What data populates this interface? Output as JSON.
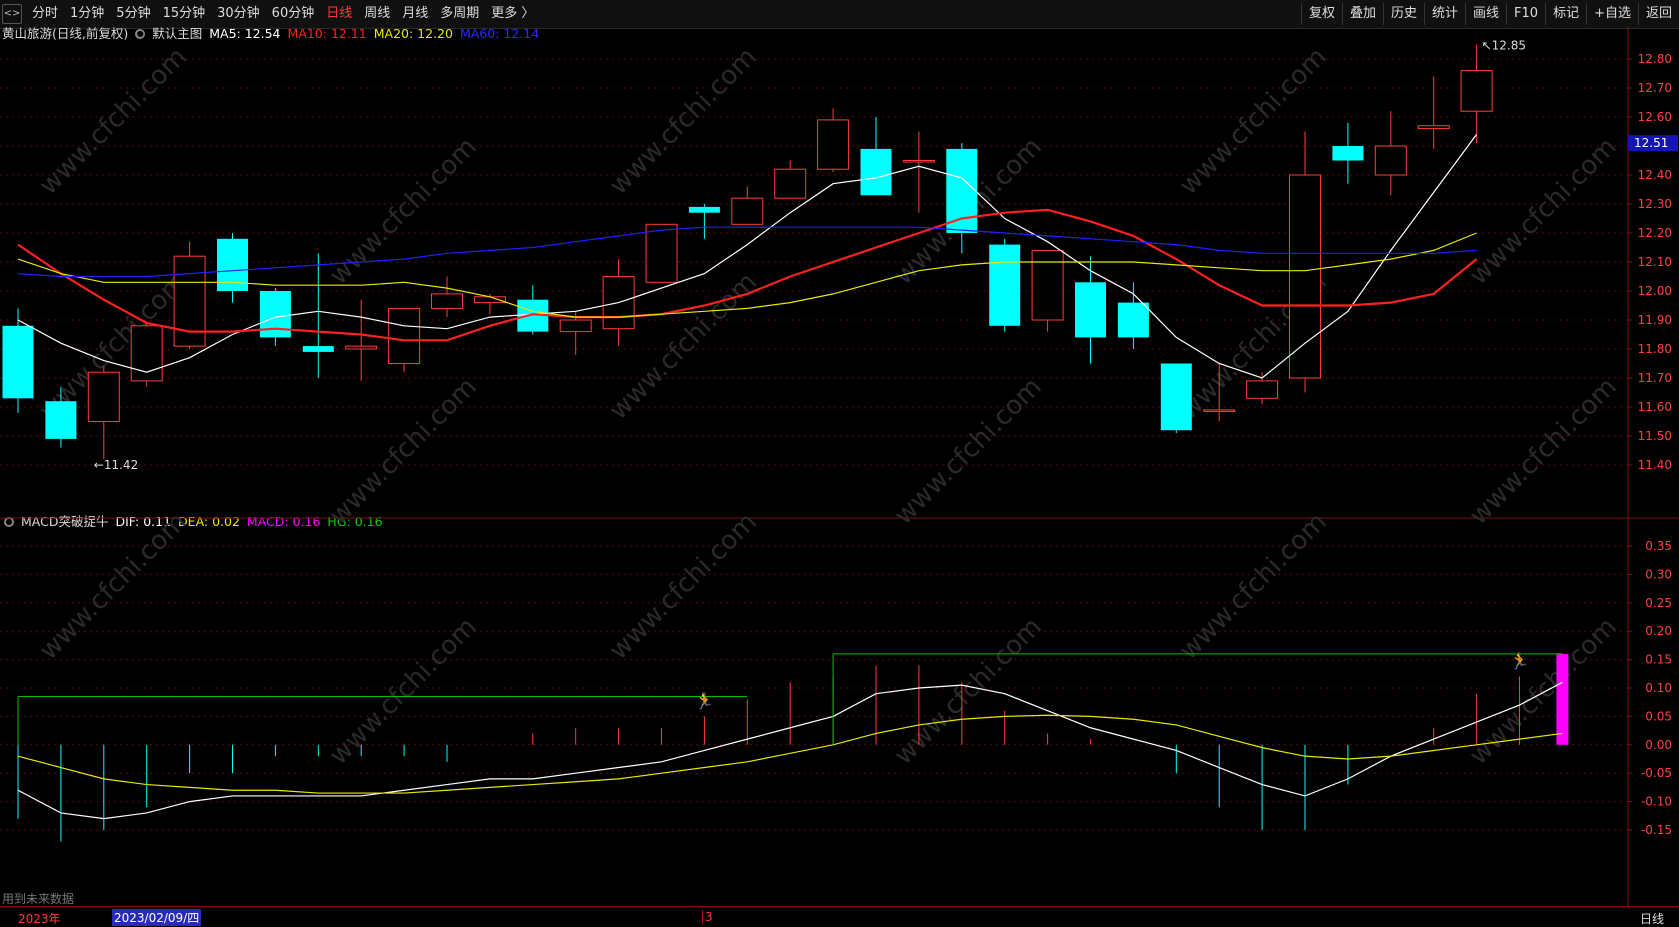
{
  "toolbar": {
    "periods": [
      "分时",
      "1分钟",
      "5分钟",
      "15分钟",
      "30分钟",
      "60分钟",
      "日线",
      "周线",
      "月线",
      "多周期",
      "更多 〉"
    ],
    "active_period": "日线",
    "right_buttons": [
      "复权",
      "叠加",
      "历史",
      "统计",
      "画线",
      "F10",
      "标记",
      "+自选",
      "返回"
    ]
  },
  "main_info": {
    "title": "黄山旅游(日线,前复权)",
    "template": "默认主图",
    "ma5": "MA5: 12.54",
    "ma10": "MA10: 12.11",
    "ma20": "MA20: 12.20",
    "ma60": "MA60: 12.14"
  },
  "macd_info": {
    "title": "MACD突破捉牛",
    "dif": "DIF: 0.11",
    "dea": "DEA: 0.02",
    "macd": "MACD: 0.16",
    "hg": "HG: 0.16"
  },
  "status": {
    "note": "用到未来数据",
    "year": "2023年",
    "cursor_date": "2023/02/09/四",
    "month_mark": "3",
    "period": "日线"
  },
  "watermark": "www.cfchi.com",
  "colors": {
    "up": "#ff3c3c",
    "down": "#00ffff",
    "ma5": "#ffffff",
    "ma10": "#ff2020",
    "ma20": "#e8e800",
    "ma60": "#2020ff",
    "dif": "#ffffff",
    "dea": "#e8e800",
    "macd_hist": "#ff00ff",
    "hg": "#00c000",
    "axis": "#7a1010"
  },
  "chart_data": [
    {
      "type": "candlestick",
      "title": "黄山旅游(日线,前复权)",
      "ylim": [
        11.35,
        12.9
      ],
      "yticks": [
        "12.80",
        "12.70",
        "12.60",
        "12.50",
        "12.40",
        "12.30",
        "12.20",
        "12.10",
        "12.00",
        "11.90",
        "11.80",
        "11.70",
        "11.60",
        "11.50",
        "11.40"
      ],
      "current_price": "12.51",
      "high_label": "12.85",
      "low_label": "11.42",
      "candles": [
        {
          "o": 11.88,
          "c": 11.63,
          "h": 11.94,
          "l": 11.58
        },
        {
          "o": 11.62,
          "c": 11.49,
          "h": 11.67,
          "l": 11.46
        },
        {
          "o": 11.55,
          "c": 11.72,
          "h": 11.74,
          "l": 11.42
        },
        {
          "o": 11.69,
          "c": 11.88,
          "h": 11.89,
          "l": 11.67
        },
        {
          "o": 11.81,
          "c": 12.12,
          "h": 12.17,
          "l": 11.8
        },
        {
          "o": 12.18,
          "c": 12.0,
          "h": 12.2,
          "l": 11.96
        },
        {
          "o": 12.0,
          "c": 11.84,
          "h": 12.01,
          "l": 11.81
        },
        {
          "o": 11.81,
          "c": 11.79,
          "h": 12.13,
          "l": 11.7
        },
        {
          "o": 11.8,
          "c": 11.81,
          "h": 11.97,
          "l": 11.69
        },
        {
          "o": 11.75,
          "c": 11.94,
          "h": 11.94,
          "l": 11.72
        },
        {
          "o": 11.94,
          "c": 11.99,
          "h": 12.05,
          "l": 11.91
        },
        {
          "o": 11.96,
          "c": 11.98,
          "h": 11.99,
          "l": 11.92
        },
        {
          "o": 11.97,
          "c": 11.86,
          "h": 12.02,
          "l": 11.85
        },
        {
          "o": 11.86,
          "c": 11.9,
          "h": 11.93,
          "l": 11.78
        },
        {
          "o": 11.87,
          "c": 12.05,
          "h": 12.11,
          "l": 11.81
        },
        {
          "o": 12.03,
          "c": 12.23,
          "h": 12.23,
          "l": 12.03
        },
        {
          "o": 12.29,
          "c": 12.27,
          "h": 12.3,
          "l": 12.18
        },
        {
          "o": 12.23,
          "c": 12.32,
          "h": 12.36,
          "l": 12.23
        },
        {
          "o": 12.32,
          "c": 12.42,
          "h": 12.45,
          "l": 12.32
        },
        {
          "o": 12.42,
          "c": 12.59,
          "h": 12.63,
          "l": 12.41
        },
        {
          "o": 12.49,
          "c": 12.33,
          "h": 12.6,
          "l": 12.33
        },
        {
          "o": 12.45,
          "c": 12.45,
          "h": 12.55,
          "l": 12.27
        },
        {
          "o": 12.49,
          "c": 12.2,
          "h": 12.51,
          "l": 12.13
        },
        {
          "o": 12.16,
          "c": 11.88,
          "h": 12.18,
          "l": 11.86
        },
        {
          "o": 11.9,
          "c": 12.14,
          "h": 12.14,
          "l": 11.86
        },
        {
          "o": 12.03,
          "c": 11.84,
          "h": 12.12,
          "l": 11.75
        },
        {
          "o": 11.96,
          "c": 11.84,
          "h": 12.03,
          "l": 11.8
        },
        {
          "o": 11.75,
          "c": 11.52,
          "h": 11.75,
          "l": 11.51
        },
        {
          "o": 11.59,
          "c": 11.59,
          "h": 11.75,
          "l": 11.55
        },
        {
          "o": 11.63,
          "c": 11.69,
          "h": 11.72,
          "l": 11.61
        },
        {
          "o": 11.7,
          "c": 12.4,
          "h": 12.55,
          "l": 11.65
        },
        {
          "o": 12.5,
          "c": 12.45,
          "h": 12.58,
          "l": 12.37
        },
        {
          "o": 12.4,
          "c": 12.5,
          "h": 12.62,
          "l": 12.33
        },
        {
          "o": 12.56,
          "c": 12.57,
          "h": 12.74,
          "l": 12.49
        },
        {
          "o": 12.62,
          "c": 12.76,
          "h": 12.85,
          "l": 12.51
        }
      ],
      "series": [
        {
          "name": "MA5",
          "values": [
            11.9,
            11.82,
            11.76,
            11.72,
            11.77,
            11.85,
            11.91,
            11.93,
            11.91,
            11.88,
            11.87,
            11.91,
            11.92,
            11.93,
            11.96,
            12.01,
            12.06,
            12.16,
            12.27,
            12.37,
            12.39,
            12.43,
            12.39,
            12.25,
            12.17,
            12.07,
            11.99,
            11.84,
            11.75,
            11.7,
            11.82,
            11.93,
            12.14,
            12.34,
            12.54
          ]
        },
        {
          "name": "MA10",
          "values": [
            12.16,
            12.06,
            11.97,
            11.89,
            11.86,
            11.86,
            11.87,
            11.86,
            11.85,
            11.83,
            11.83,
            11.88,
            11.92,
            11.91,
            11.91,
            11.92,
            11.95,
            11.99,
            12.05,
            12.1,
            12.15,
            12.2,
            12.25,
            12.27,
            12.28,
            12.24,
            12.19,
            12.11,
            12.02,
            11.95,
            11.95,
            11.95,
            11.96,
            11.99,
            12.11
          ]
        },
        {
          "name": "MA20",
          "values": [
            12.11,
            12.06,
            12.03,
            12.03,
            12.03,
            12.03,
            12.02,
            12.02,
            12.02,
            12.03,
            12.01,
            11.98,
            11.93,
            11.91,
            11.91,
            11.92,
            11.93,
            11.94,
            11.96,
            11.99,
            12.03,
            12.07,
            12.09,
            12.1,
            12.1,
            12.1,
            12.1,
            12.09,
            12.08,
            12.07,
            12.07,
            12.09,
            12.11,
            12.14,
            12.2
          ]
        },
        {
          "name": "MA60",
          "values": [
            12.06,
            12.05,
            12.05,
            12.05,
            12.06,
            12.07,
            12.08,
            12.09,
            12.1,
            12.11,
            12.13,
            12.14,
            12.15,
            12.17,
            12.19,
            12.21,
            12.22,
            12.22,
            12.22,
            12.22,
            12.22,
            12.22,
            12.21,
            12.2,
            12.19,
            12.18,
            12.17,
            12.16,
            12.14,
            12.13,
            12.13,
            12.13,
            12.13,
            12.13,
            12.14
          ]
        }
      ]
    },
    {
      "type": "macd",
      "title": "MACD突破捉牛",
      "ylim": [
        -0.2,
        0.38
      ],
      "yticks": [
        "0.35",
        "0.30",
        "0.25",
        "0.20",
        "0.15",
        "0.10",
        "0.05",
        "0.00",
        "-0.05",
        "-0.10",
        "-0.15"
      ],
      "histogram": [
        -0.13,
        -0.17,
        -0.15,
        -0.11,
        -0.05,
        -0.05,
        -0.02,
        -0.02,
        -0.02,
        -0.02,
        -0.03,
        0.0,
        0.02,
        0.03,
        0.03,
        0.03,
        0.05,
        0.08,
        0.11,
        0.12,
        0.14,
        0.14,
        0.11,
        0.06,
        0.02,
        0.01,
        0.0,
        -0.05,
        -0.11,
        -0.15,
        -0.15,
        -0.07,
        0.0,
        0.03,
        0.09,
        0.12,
        0.16
      ],
      "dif": [
        -0.08,
        -0.12,
        -0.13,
        -0.12,
        -0.1,
        -0.09,
        -0.09,
        -0.09,
        -0.09,
        -0.08,
        -0.07,
        -0.06,
        -0.06,
        -0.05,
        -0.04,
        -0.03,
        -0.01,
        0.01,
        0.03,
        0.05,
        0.09,
        0.1,
        0.105,
        0.09,
        0.06,
        0.03,
        0.01,
        -0.01,
        -0.04,
        -0.07,
        -0.09,
        -0.06,
        -0.02,
        0.01,
        0.04,
        0.07,
        0.11
      ],
      "dea": [
        -0.02,
        -0.04,
        -0.06,
        -0.07,
        -0.075,
        -0.08,
        -0.08,
        -0.085,
        -0.085,
        -0.085,
        -0.08,
        -0.075,
        -0.07,
        -0.065,
        -0.06,
        -0.05,
        -0.04,
        -0.03,
        -0.015,
        0.0,
        0.02,
        0.035,
        0.045,
        0.05,
        0.052,
        0.05,
        0.045,
        0.035,
        0.015,
        -0.005,
        -0.02,
        -0.025,
        -0.02,
        -0.01,
        0.0,
        0.01,
        0.02
      ],
      "hg_levels": [
        {
          "from": 0,
          "to": 17,
          "value": 0.085
        },
        {
          "from": 19,
          "to": 36,
          "value": 0.16
        }
      ],
      "signals": [
        16,
        35
      ]
    }
  ]
}
